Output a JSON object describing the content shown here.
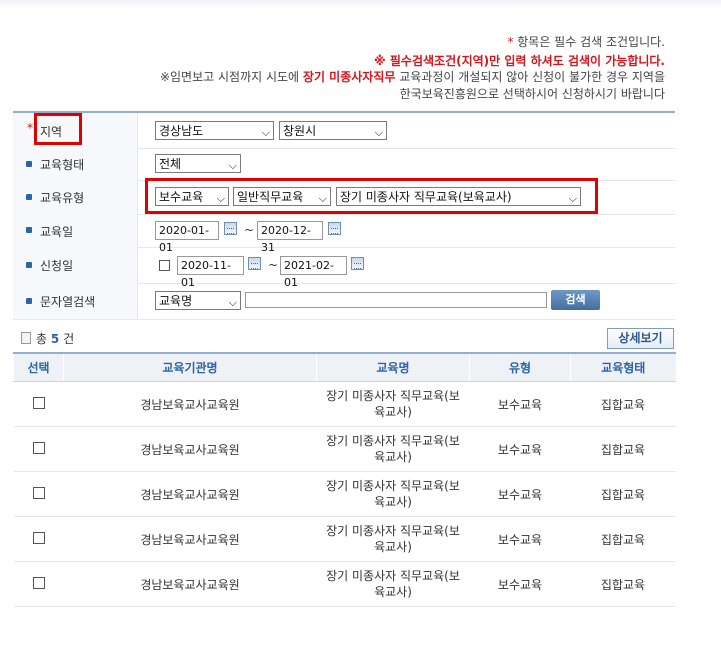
{
  "notices": {
    "line1_star": "*",
    "line1_text": " 항목은 필수 검색 조건입니다.",
    "line2": "※ 필수검색조건(지역)만 입력 하셔도 검색이 가능합니다.",
    "line3_pre": "※임면보고 시점까지 시도에 ",
    "line3_highlight": "장기 미종사자직무",
    "line3_post": " 교육과정이 개설되지 않아 신청이 불가한 경우 지역을",
    "line4": "한국보육진흥원으로 선택하시어 신청하시기 바랍니다"
  },
  "form": {
    "region": {
      "star": "*",
      "label": "지역",
      "province": "경상남도",
      "city": "창원시"
    },
    "edu_form": {
      "label": "교육형태",
      "value": "전체"
    },
    "edu_type": {
      "label": "교육유형",
      "type1": "보수교육",
      "type2": "일반직무교육",
      "type3": "장기 미종사자 직무교육(보육교사)"
    },
    "edu_date": {
      "label": "교육일",
      "from": "2020-01-01",
      "to": "2020-12-31",
      "tilde": "~"
    },
    "apply_date": {
      "label": "신청일",
      "from": "2020-11-01",
      "to": "2021-02-01",
      "tilde": "~"
    },
    "text_search": {
      "label": "문자열검색",
      "field": "교육명",
      "query": "",
      "button": "검색"
    }
  },
  "results": {
    "total_prefix": "총",
    "total_count": "5",
    "total_suffix": "건",
    "detail_button": "상세보기",
    "columns": {
      "select": "선택",
      "institution": "교육기관명",
      "course": "교육명",
      "type": "유형",
      "form": "교육형태"
    },
    "rows": [
      {
        "institution": "경남보육교사교육원",
        "course": "장기 미종사자 직무교육(보육교사)",
        "type": "보수교육",
        "form": "집합교육"
      },
      {
        "institution": "경남보육교사교육원",
        "course": "장기 미종사자 직무교육(보육교사)",
        "type": "보수교육",
        "form": "집합교육"
      },
      {
        "institution": "경남보육교사교육원",
        "course": "장기 미종사자 직무교육(보육교사)",
        "type": "보수교육",
        "form": "집합교육"
      },
      {
        "institution": "경남보육교사교육원",
        "course": "장기 미종사자 직무교육(보육교사)",
        "type": "보수교육",
        "form": "집합교육"
      },
      {
        "institution": "경남보육교사교육원",
        "course": "장기 미종사자 직무교육(보육교사)",
        "type": "보수교육",
        "form": "집합교육"
      }
    ]
  },
  "colors": {
    "accent": "#2d64a8",
    "required": "#d8141b",
    "highlight_box": "#e00000"
  },
  "icons": {
    "date_picker": "calendar-icon",
    "dropdown": "chevron-down-icon",
    "total": "document-icon"
  }
}
